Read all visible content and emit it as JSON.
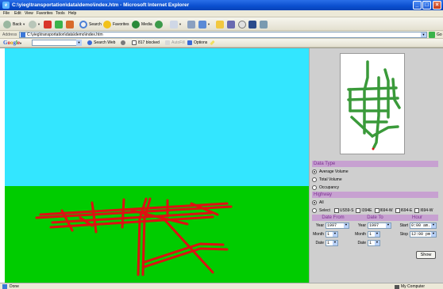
{
  "window": {
    "title": "C:\\yieg\\transportation\\data\\demo\\index.htm - Microsoft Internet Explorer"
  },
  "menu": [
    "File",
    "Edit",
    "View",
    "Favorites",
    "Tools",
    "Help"
  ],
  "toolbar": {
    "back_label": "Back",
    "search_label": "Search",
    "favorites_label": "Favorites",
    "media_label": "Media"
  },
  "address": {
    "label": "Address",
    "url": "C:\\yieg\\transportation\\data\\demo\\index.htm",
    "go_label": "Go"
  },
  "google_toolbar": {
    "logo": "Google",
    "search_web_label": "Search Web",
    "blocked_label": "817 blocked",
    "autofill_label": "AutoFill",
    "options_label": "Options"
  },
  "scene": {
    "sky_color": "#33e6ff",
    "ground_color": "#00cc00",
    "road_color": "#dd1111"
  },
  "panel": {
    "map_road_color": "#3a9a3a",
    "data_type_header": "Data Type",
    "data_type_options": [
      {
        "label": "Average Volume",
        "selected": true
      },
      {
        "label": "Total Volume",
        "selected": false
      },
      {
        "label": "Occupancy",
        "selected": false
      }
    ],
    "highway_header": "Highway",
    "highway_all_label": "All",
    "highway_select_label": "Select",
    "highway_checkboxes": [
      "US59-S",
      "I394E",
      "I694-W",
      "I694-E",
      "I694-W"
    ],
    "date_from_header": "Date From",
    "date_to_header": "Date To",
    "hour_header": "Hour",
    "from": {
      "year_label": "Year",
      "year": "1997",
      "month_label": "Month",
      "month": "1",
      "date_label": "Date",
      "date": "1"
    },
    "to": {
      "year_label": "Year",
      "year": "1997",
      "month_label": "Month",
      "month": "1",
      "date_label": "Date",
      "date": "1"
    },
    "hour": {
      "start_label": "Start",
      "start": "0:00 am.",
      "stop_label": "Stop",
      "stop": "12:00 pm"
    },
    "show_button": "Show"
  },
  "status": {
    "text": "Done",
    "zone": "My Computer"
  }
}
